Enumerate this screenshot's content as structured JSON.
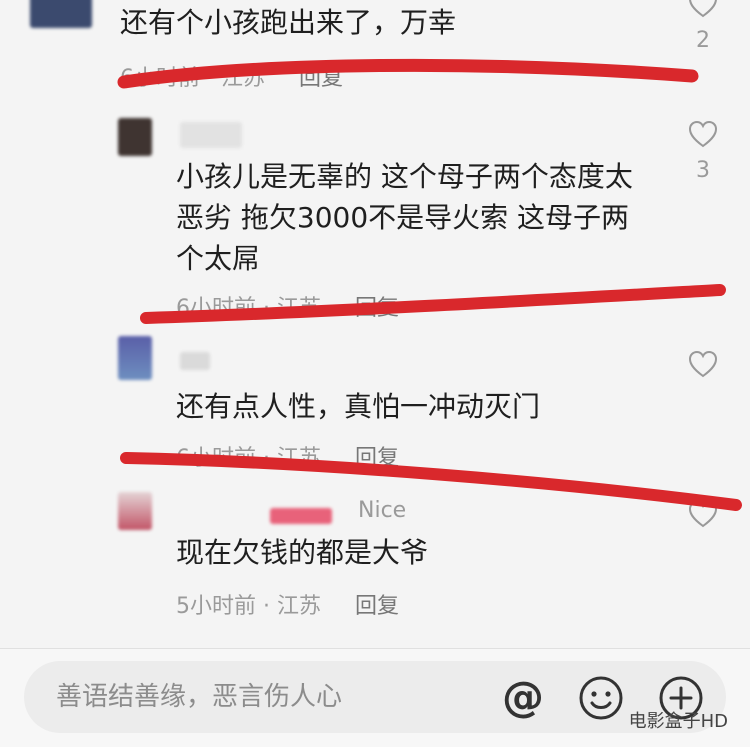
{
  "comments": [
    {
      "text": "还有个小孩跑出来了，万幸",
      "meta": "6小时前 · 江苏",
      "reply": "回复",
      "likes": "2"
    },
    {
      "text": "小孩儿是无辜的 这个母子两个态度太恶劣 拖欠3000不是导火索 这母子两个太屌",
      "meta": "6小时前 · 江苏",
      "reply": "回复",
      "likes": "3"
    },
    {
      "text": "还有点人性，真怕一冲动灭门",
      "meta": "6小时前 · 江苏",
      "reply": "回复"
    },
    {
      "name": "Nice",
      "text": "现在欠钱的都是大爷",
      "meta": "5小时前 · 江苏",
      "reply": "回复"
    }
  ],
  "input": {
    "placeholder": "善语结善缘，恶言伤人心"
  },
  "watermark": "电影盒子HD",
  "icons": [
    "heart-icon",
    "at-icon",
    "emoji-icon",
    "add-icon"
  ],
  "colors": {
    "annotation": "#d9282c",
    "background": "#f4f4f4"
  }
}
